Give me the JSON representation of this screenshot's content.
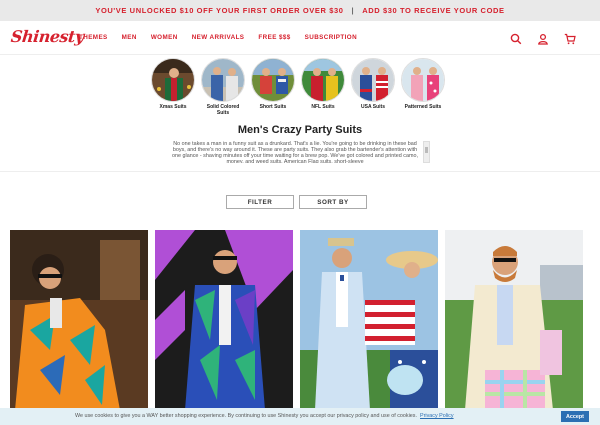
{
  "promo": {
    "left": "YOU'VE UNLOCKED $10 OFF YOUR FIRST ORDER OVER $30",
    "separator": "|",
    "right": "ADD $30 TO RECEIVE YOUR CODE"
  },
  "logo": "Shinesty",
  "menu": [
    "THEMES",
    "MEN",
    "WOMEN",
    "NEW ARRIVALS",
    "FREE $$$",
    "SUBSCRIPTION"
  ],
  "nav_icons": [
    "search-icon",
    "account-icon",
    "cart-icon"
  ],
  "categories": [
    {
      "label": "Xmas Suits",
      "icon": "xmas-suits-image"
    },
    {
      "label": "Solid Colored Suits",
      "icon": "solid-colored-suits-image"
    },
    {
      "label": "Short Suits",
      "icon": "short-suits-image"
    },
    {
      "label": "NFL Suits",
      "icon": "nfl-suits-image"
    },
    {
      "label": "USA Suits",
      "icon": "usa-suits-image"
    },
    {
      "label": "Patterned Suits",
      "icon": "patterned-suits-image"
    }
  ],
  "page_title": "Men's Crazy Party Suits",
  "description": "No one takes a man in a funny suit as a drunkard. That's a lie. You're going to be drinking in these bad boys, and there's no way around it. These are party suits. They also grab the bartender's attention with one glance - shaving minutes off your time waiting for a brew pop. We've got colored and printed camo, money, and weed suits, American Flag suits, short-sleeve",
  "filter_label": "FILTER",
  "sort_label": "SORT BY",
  "products": [
    "tropical-suit-photo",
    "geometric-suit-photo",
    "usa-flag-suit-photo",
    "pastel-plaid-suit-photo"
  ],
  "cookie": {
    "text": "We use cookies to give you a WAY better shopping experience. By continuing to use Shinesty you accept our privacy policy and use of cookies.",
    "link": "Privacy Policy",
    "accept": "Accept"
  },
  "colors": {
    "brand": "#d6212e",
    "promo_bg": "#e9e9e9",
    "cookie_bg": "#e3f0f5",
    "accept_btn": "#2b6fb3"
  }
}
